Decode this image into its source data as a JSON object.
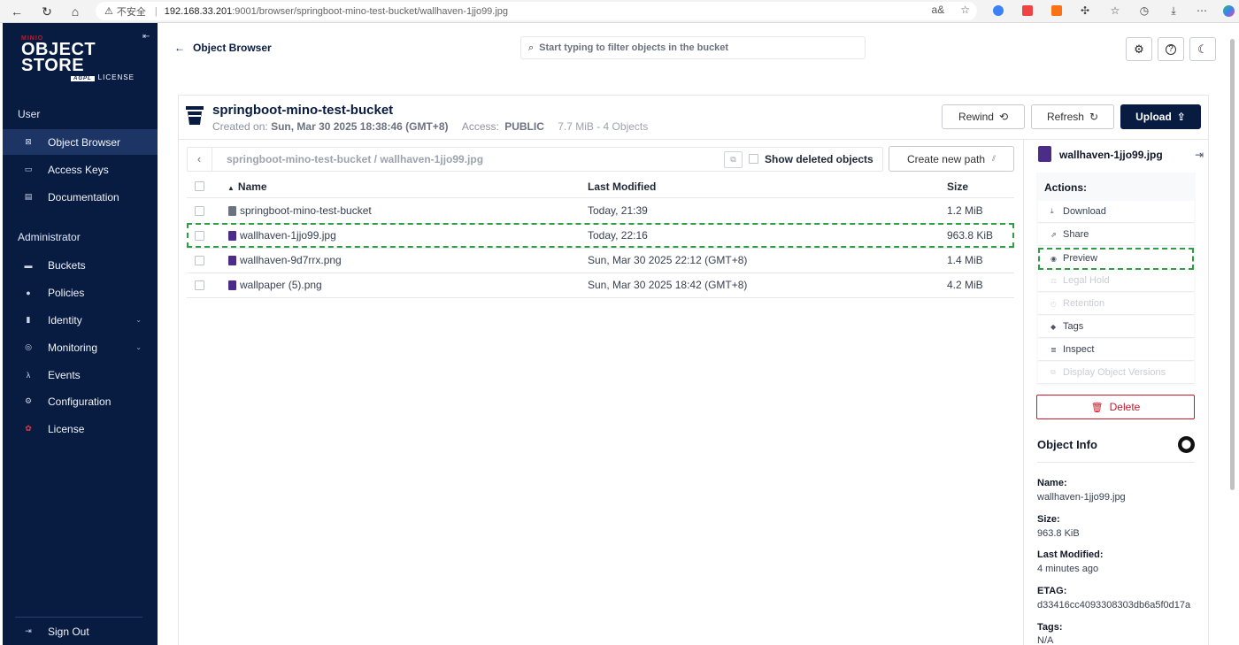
{
  "browser": {
    "insecure_label": "不安全",
    "url_host": "192.168.33.201",
    "url_rest": ":9001/browser/springboot-mino-test-bucket/wallhaven-1jjo99.jpg"
  },
  "sidebar": {
    "logo": {
      "brand": "MINIO",
      "product": "OBJECT STORE",
      "badge": "AGPL",
      "license": "LICENSE"
    },
    "user_section": "User",
    "user_items": [
      {
        "label": "Object Browser",
        "icon": "object-browser-icon",
        "active": true
      },
      {
        "label": "Access Keys",
        "icon": "key-icon"
      },
      {
        "label": "Documentation",
        "icon": "docs-icon"
      }
    ],
    "admin_section": "Administrator",
    "admin_items": [
      {
        "label": "Buckets",
        "icon": "bucket-icon"
      },
      {
        "label": "Policies",
        "icon": "policy-icon"
      },
      {
        "label": "Identity",
        "icon": "identity-icon",
        "expandable": true
      },
      {
        "label": "Monitoring",
        "icon": "monitoring-icon",
        "expandable": true
      },
      {
        "label": "Events",
        "icon": "lambda-icon"
      },
      {
        "label": "Configuration",
        "icon": "gear-icon"
      },
      {
        "label": "License",
        "icon": "license-icon"
      }
    ],
    "sign_out": "Sign Out"
  },
  "topbar": {
    "back_label": "Object Browser",
    "search_placeholder": "Start typing to filter objects in the bucket"
  },
  "bucket": {
    "name": "springboot-mino-test-bucket",
    "created_label": "Created on:",
    "created_value": "Sun, Mar 30 2025 18:38:46 (GMT+8)",
    "access_label": "Access:",
    "access_value": "PUBLIC",
    "usage": "7.7 MiB - 4 Objects",
    "buttons": {
      "rewind": "Rewind",
      "refresh": "Refresh",
      "upload": "Upload"
    }
  },
  "browser_bar": {
    "path": "springboot-mino-test-bucket / wallhaven-1jjo99.jpg",
    "show_deleted": "Show deleted objects",
    "create_path": "Create new path"
  },
  "table": {
    "columns": {
      "name": "Name",
      "modified": "Last Modified",
      "size": "Size"
    },
    "rows": [
      {
        "name": "springboot-mino-test-bucket",
        "modified": "Today, 21:39",
        "size": "1.2 MiB",
        "type": "file"
      },
      {
        "name": "wallhaven-1jjo99.jpg",
        "modified": "Today, 22:16",
        "size": "963.8 KiB",
        "type": "image",
        "selected": true
      },
      {
        "name": "wallhaven-9d7rrx.png",
        "modified": "Sun, Mar 30 2025 22:12 (GMT+8)",
        "size": "1.4 MiB",
        "type": "image"
      },
      {
        "name": "wallpaper (5).png",
        "modified": "Sun, Mar 30 2025 18:42 (GMT+8)",
        "size": "4.2 MiB",
        "type": "image"
      }
    ]
  },
  "details": {
    "file_name": "wallhaven-1jjo99.jpg",
    "actions_title": "Actions:",
    "actions": [
      {
        "label": "Download",
        "icon": "download-icon",
        "enabled": true
      },
      {
        "label": "Share",
        "icon": "share-icon",
        "enabled": true
      },
      {
        "label": "Preview",
        "icon": "eye-icon",
        "enabled": true,
        "highlighted": true
      },
      {
        "label": "Legal Hold",
        "icon": "legal-hold-icon",
        "enabled": false
      },
      {
        "label": "Retention",
        "icon": "retention-icon",
        "enabled": false
      },
      {
        "label": "Tags",
        "icon": "tag-icon",
        "enabled": true
      },
      {
        "label": "Inspect",
        "icon": "inspect-icon",
        "enabled": true
      },
      {
        "label": "Display Object Versions",
        "icon": "versions-icon",
        "enabled": false
      }
    ],
    "delete_label": "Delete",
    "info_title": "Object Info",
    "info": [
      {
        "label": "Name:",
        "value": "wallhaven-1jjo99.jpg"
      },
      {
        "label": "Size:",
        "value": "963.8 KiB"
      },
      {
        "label": "Last Modified:",
        "value": "4 minutes ago"
      },
      {
        "label": "ETAG:",
        "value": "d33416cc4093308303db6a5f0d17a"
      },
      {
        "label": "Tags:",
        "value": "N/A"
      }
    ]
  },
  "colors": {
    "sidebar_bg": "#081c42",
    "primary": "#081c42",
    "danger": "#c9162b",
    "highlight": "#2e9e44",
    "file_icon": "#4b2c88"
  }
}
